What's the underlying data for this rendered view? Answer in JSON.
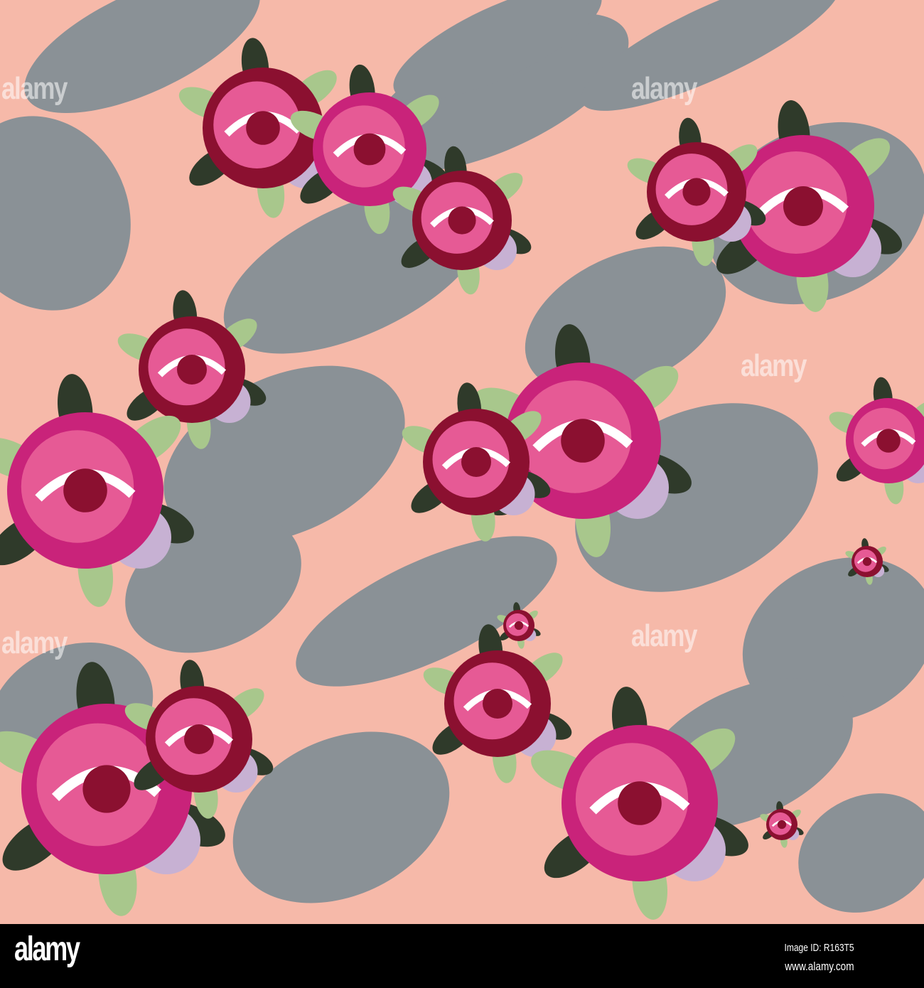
{
  "watermark": {
    "text": "alamy"
  },
  "footer": {
    "logo": "alamy",
    "image_id": "Image ID: R163T5",
    "website": "www.alamy.com"
  },
  "colors": {
    "background": "#f6b9a9",
    "shadow": "#8a9196",
    "rose_dark": "#8b1030",
    "rose_magenta": "#c9237a",
    "rose_pink": "#e65a95",
    "lavender": "#c7b1d3",
    "leaf": "#a8c78c",
    "leaf_dark": "#2f3a2a"
  }
}
